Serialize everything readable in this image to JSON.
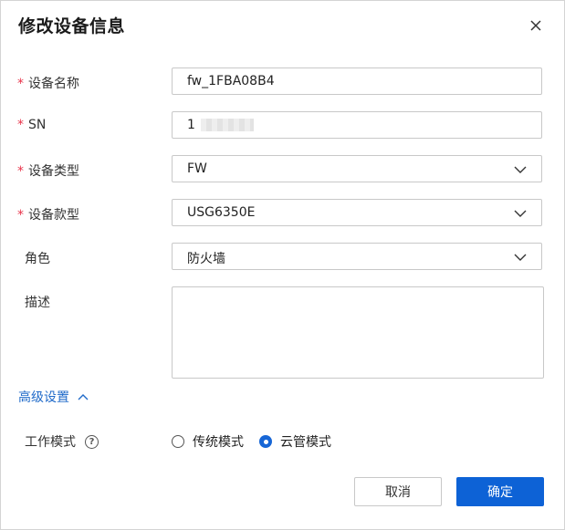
{
  "dialog": {
    "title": "修改设备信息",
    "close_icon": "close-icon"
  },
  "form": {
    "required_mark": "*",
    "device_name": {
      "label": "设备名称",
      "value": "fw_1FBA08B4"
    },
    "sn": {
      "label": "SN",
      "value": "1"
    },
    "device_type": {
      "label": "设备类型",
      "value": "FW"
    },
    "device_model": {
      "label": "设备款型",
      "value": "USG6350E"
    },
    "role": {
      "label": "角色",
      "value": "防火墙"
    },
    "description": {
      "label": "描述",
      "value": ""
    }
  },
  "advanced": {
    "label": "高级设置",
    "expanded": true,
    "work_mode": {
      "label": "工作模式",
      "help_icon": "?",
      "options": [
        {
          "label": "传统模式",
          "selected": false
        },
        {
          "label": "云管模式",
          "selected": true
        }
      ]
    }
  },
  "footer": {
    "cancel_label": "取消",
    "confirm_label": "确定"
  },
  "colors": {
    "primary": "#0d62d6",
    "link": "#1f6ac9",
    "required": "#e8334a"
  }
}
